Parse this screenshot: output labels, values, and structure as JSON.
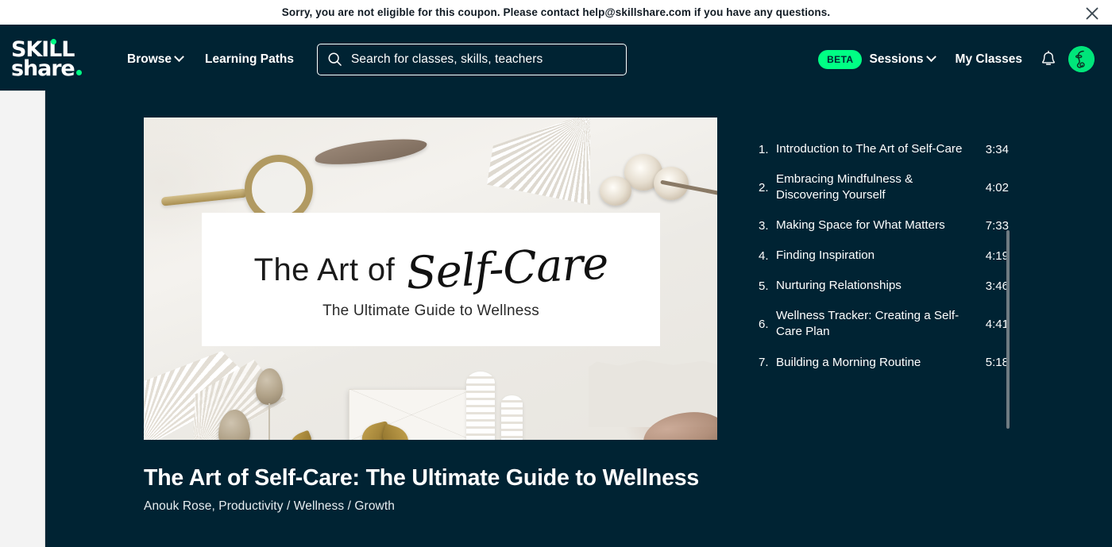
{
  "banner": {
    "message": "Sorry, you are not eligible for this coupon. Please contact help@skillshare.com if you have any questions.",
    "close_icon": "close-icon"
  },
  "header": {
    "logo": {
      "line1": "SKILL",
      "line2": "share",
      "dot_color": "#00ff84"
    },
    "nav": [
      {
        "label": "Browse",
        "has_chevron": true
      },
      {
        "label": "Learning Paths",
        "has_chevron": false
      }
    ],
    "search": {
      "placeholder": "Search for classes, skills, teachers",
      "icon": "search-icon",
      "value": ""
    },
    "beta_badge": "BETA",
    "sessions_label": "Sessions",
    "my_classes_label": "My Classes",
    "bell_icon": "notification-bell-icon",
    "avatar_icon": "user-avatar",
    "background": "#002333"
  },
  "cover": {
    "title_part_1": "The Art of",
    "title_part_2": "Self-Care",
    "subtitle": "The Ultimate Guide to Wellness"
  },
  "video": {
    "title": "The Art of Self-Care: The Ultimate Guide to Wellness",
    "byline": "Anouk Rose, Productivity / Wellness / Growth"
  },
  "playlist": {
    "items": [
      {
        "num": "1.",
        "label": "Introduction to The Art of Self-Care",
        "time": "3:34"
      },
      {
        "num": "2.",
        "label": "Embracing Mindfulness & Discovering Yourself",
        "time": "4:02"
      },
      {
        "num": "3.",
        "label": "Making Space for What Matters",
        "time": "7:33"
      },
      {
        "num": "4.",
        "label": "Finding Inspiration",
        "time": "4:19"
      },
      {
        "num": "5.",
        "label": "Nurturing Relationships",
        "time": "3:46"
      },
      {
        "num": "6.",
        "label": "Wellness Tracker: Creating a Self-Care Plan",
        "time": "4:41"
      },
      {
        "num": "7.",
        "label": "Building a Morning Routine",
        "time": "5:18"
      }
    ]
  },
  "colors": {
    "page_background": "#002333",
    "accent_green": "#00ff84",
    "banner_background": "#ffffff",
    "text_light": "#ffffff"
  }
}
